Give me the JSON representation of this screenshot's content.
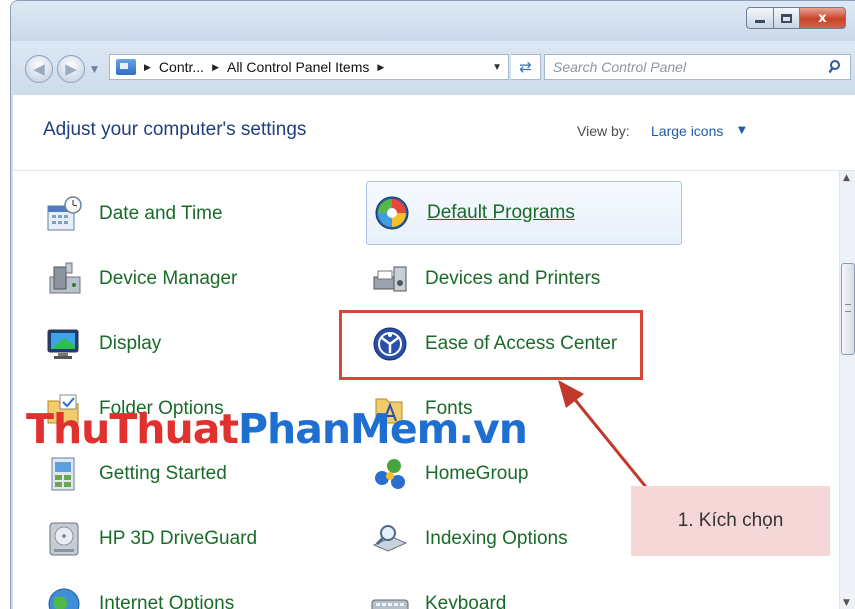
{
  "window": {
    "caption": {
      "close_glyph": "x"
    }
  },
  "navigation": {
    "breadcrumb": [
      "Contr...",
      "All Control Panel Items"
    ],
    "search_placeholder": "Search Control Panel"
  },
  "header": {
    "title": "Adjust your computer's settings",
    "view_by_label": "View by:",
    "view_by_value": "Large icons"
  },
  "items": {
    "left": [
      {
        "label": "Date and Time",
        "icon": "calendar-clock-icon"
      },
      {
        "label": "Device Manager",
        "icon": "device-manager-icon"
      },
      {
        "label": "Display",
        "icon": "monitor-icon"
      },
      {
        "label": "Folder Options",
        "icon": "folder-options-icon"
      },
      {
        "label": "Getting Started",
        "icon": "getting-started-icon"
      },
      {
        "label": "HP 3D DriveGuard",
        "icon": "hard-drive-icon"
      },
      {
        "label": "Internet Options",
        "icon": "globe-icon"
      }
    ],
    "right": [
      {
        "label": "Default Programs",
        "icon": "default-programs-icon",
        "hovered": true
      },
      {
        "label": "Devices and Printers",
        "icon": "printer-icon"
      },
      {
        "label": "Ease of Access Center",
        "icon": "ease-of-access-icon"
      },
      {
        "label": "Fonts",
        "icon": "fonts-folder-icon"
      },
      {
        "label": "HomeGroup",
        "icon": "homegroup-icon"
      },
      {
        "label": "Indexing Options",
        "icon": "indexing-icon"
      },
      {
        "label": "Keyboard",
        "icon": "keyboard-icon"
      }
    ]
  },
  "annotation": {
    "note": "1. Kích chọn",
    "highlight_color": "#d9443a",
    "note_background": "#f6d7d7"
  },
  "watermark": {
    "part1": "ThuThuat",
    "part2": "PhanMem.vn"
  },
  "colors": {
    "item_label": "#1a6b2a",
    "heading": "#1e3f7a",
    "link": "#1f5aa6"
  }
}
